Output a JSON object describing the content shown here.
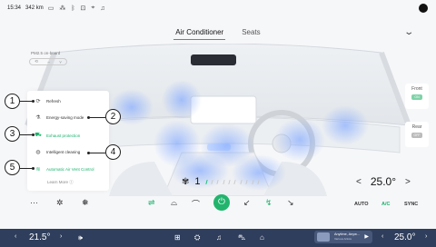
{
  "status": {
    "time": "15:34",
    "range": "342 km",
    "icons": [
      "battery-icon",
      "signal-icon",
      "bluetooth-icon",
      "lock-icon",
      "location-icon",
      "bell-icon"
    ]
  },
  "tabs": [
    {
      "label": "Air Conditioner",
      "active": true
    },
    {
      "label": "Seats",
      "active": false
    }
  ],
  "pm": {
    "label": "PM2.5 on-board",
    "value": "--"
  },
  "menu": {
    "items": [
      {
        "label": "Refresh",
        "icon": "refresh-icon",
        "green": false
      },
      {
        "label": "Energy-saving mode",
        "icon": "leaf-icon",
        "green": false
      },
      {
        "label": "Exhaust protection",
        "icon": "car-icon",
        "green": true
      },
      {
        "label": "Intelligent cleaning",
        "icon": "clean-icon",
        "green": false
      },
      {
        "label": "Automatic Air Vent Control",
        "icon": "vent-icon",
        "green": true
      }
    ],
    "learn_more": "Learn More"
  },
  "callouts": [
    "1",
    "2",
    "3",
    "4",
    "5"
  ],
  "seats": {
    "front": {
      "label": "Front",
      "state": "ON"
    },
    "rear": {
      "label": "Rear",
      "state": "OFF"
    }
  },
  "fan": {
    "level": "1",
    "levels_total": 10,
    "levels_on": 1
  },
  "cabin_temp": {
    "value": "25.0°"
  },
  "controls": {
    "auto": "AUTO",
    "ac": "A/C",
    "sync": "SYNC"
  },
  "dock": {
    "left_temp": "21.5°",
    "right_temp": "25.0°",
    "media_title": "Anytime, Anyw...",
    "media_sub": "Various Artists"
  },
  "colors": {
    "accent": "#19b36b",
    "dock": "#2f3e5c"
  }
}
